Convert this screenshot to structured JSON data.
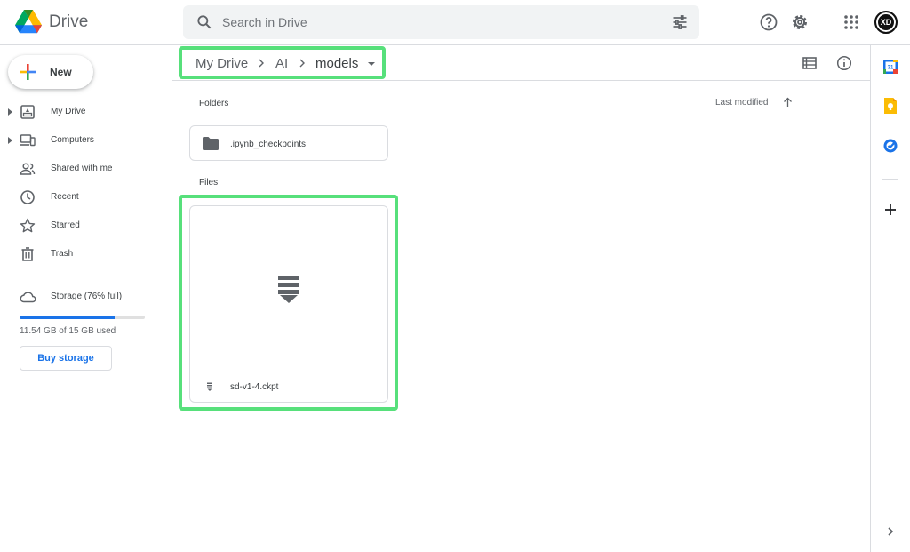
{
  "header": {
    "app_name": "Drive",
    "search_placeholder": "Search in Drive",
    "avatar_initials": "XD"
  },
  "sidebar": {
    "new_label": "New",
    "items": [
      {
        "label": "My Drive",
        "icon": "my-drive-icon",
        "expandable": true
      },
      {
        "label": "Computers",
        "icon": "computers-icon",
        "expandable": true
      },
      {
        "label": "Shared with me",
        "icon": "shared-icon",
        "expandable": false
      },
      {
        "label": "Recent",
        "icon": "clock-icon",
        "expandable": false
      },
      {
        "label": "Starred",
        "icon": "star-icon",
        "expandable": false
      },
      {
        "label": "Trash",
        "icon": "trash-icon",
        "expandable": false
      }
    ],
    "storage": {
      "label": "Storage (76% full)",
      "used_fraction": 0.76,
      "usage_text": "11.54 GB of 15 GB used",
      "buy_label": "Buy storage"
    }
  },
  "breadcrumb": {
    "items": [
      "My Drive",
      "AI",
      "models"
    ]
  },
  "main": {
    "folders_label": "Folders",
    "files_label": "Files",
    "sort_label": "Last modified",
    "folders": [
      ".ipynb_checkpoints"
    ],
    "files": [
      {
        "name": "sd-v1-4.ckpt",
        "icon": "download-stack-icon"
      }
    ]
  },
  "colors": {
    "accent": "#1a73e8",
    "highlight": "#57e07b",
    "border": "#dadce0"
  }
}
